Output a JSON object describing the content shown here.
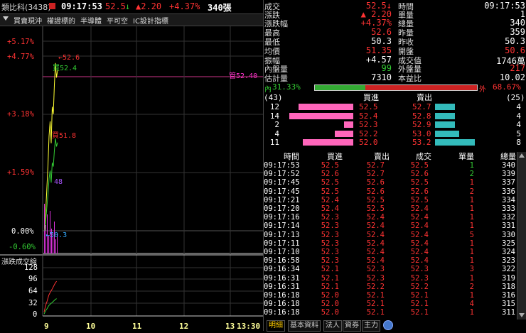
{
  "header": {
    "stock_name": "類比科(3438)",
    "time": "09:17:53",
    "price": "52.5",
    "price_arrow": "↓",
    "change": "▲2.20",
    "change_pct": "+4.37%",
    "volume": "340張"
  },
  "menu": {
    "items": [
      "買賣現沖",
      "權證標的",
      "半導體",
      "平可空",
      "IC設計指標"
    ]
  },
  "chart": {
    "y_labels": [
      {
        "text": "+5.17%",
        "color": "#ff3333"
      },
      {
        "text": "+4.77%",
        "color": "#ff3333"
      },
      {
        "text": "+3.18%",
        "color": "#ff3333"
      },
      {
        "text": "+1.59%",
        "color": "#ff3333"
      },
      {
        "text": "0.00%",
        "color": "#ffffff"
      },
      {
        "text": "-0.60%",
        "color": "#33cc33"
      }
    ],
    "annotations": {
      "high": "←52.6",
      "buy": "買52.4",
      "sell_right": "管52.40",
      "mid": "買51.8",
      "p48": "48",
      "low": "←50.3"
    },
    "sub_title": "漲跌成交線",
    "sub_y_labels": [
      "128",
      "96",
      "64",
      "32",
      "0"
    ],
    "x_labels": [
      "9",
      "10",
      "11",
      "12",
      "13",
      "13:30"
    ]
  },
  "chart_data": {
    "type": "line",
    "title": "",
    "x_ticks": [
      "9",
      "10",
      "11",
      "12",
      "13",
      "13:30"
    ],
    "y_ticks_pct": [
      "+5.17%",
      "+4.77%",
      "+3.18%",
      "+1.59%",
      "0.00%",
      "-0.60%"
    ],
    "series": [
      {
        "name": "price",
        "values": [
          50.3,
          50.6,
          50.9,
          51.2,
          51.6,
          51.8,
          51.5,
          52.0,
          51.9,
          52.3,
          52.6,
          52.4,
          52.5
        ]
      }
    ],
    "sub_series": [
      {
        "name": "漲跌成交線",
        "values": [
          10,
          28,
          40,
          55,
          63,
          70,
          78,
          86,
          92
        ]
      }
    ]
  },
  "quote": {
    "rows": [
      {
        "l1": "成交",
        "v1": "52.5↓",
        "c1": "#ff3333",
        "l2": "時間",
        "v2": "09:17:53",
        "c2": "#ffffff"
      },
      {
        "l1": "漲跌",
        "v1": "▲ 2.20",
        "c1": "#ff3333",
        "l2": "單量",
        "v2": "1",
        "c2": "#ffffff"
      },
      {
        "l1": "漲跌幅",
        "v1": "+4.37%",
        "c1": "#ff3333",
        "l2": "總量",
        "v2": "340",
        "c2": "#ffffff"
      },
      {
        "l1": "最高",
        "v1": "52.6",
        "c1": "#ff3333",
        "l2": "昨量",
        "v2": "359",
        "c2": "#ffffff"
      },
      {
        "l1": "最低",
        "v1": "50.3",
        "c1": "#ffffff",
        "l2": "昨收",
        "v2": "50.3",
        "c2": "#ffffff"
      },
      {
        "l1": "均價",
        "v1": "51.35",
        "c1": "#ff3333",
        "l2": "開盤",
        "v2": "50.6",
        "c2": "#ff3333"
      },
      {
        "l1": "振幅",
        "v1": "+4.57",
        "c1": "#ffffff",
        "l2": "成交值",
        "v2": "1746萬",
        "c2": "#ffffff"
      },
      {
        "l1": "內盤量",
        "v1": "99",
        "c1": "#33cc33",
        "l2": "外盤量",
        "v2": "217",
        "c2": "#ff3333"
      },
      {
        "l1": "估計量",
        "v1": "7310",
        "c1": "#ffffff",
        "l2": "本益比",
        "v2": "10.02",
        "c2": "#ffffff"
      }
    ],
    "inner_label": "內",
    "inner_pct": "31.33%",
    "inner_fraction": 0.3133,
    "outer_label": "外",
    "outer_pct": "68.67%"
  },
  "order_book": {
    "left_total": "(43)",
    "right_total": "(25)",
    "bid_header": "買進",
    "ask_header": "賣出",
    "rows": [
      {
        "bid_qty": "12",
        "bid": "52.5",
        "ask": "52.7",
        "ask_qty": "4",
        "bid_frac": 0.86,
        "ask_frac": 0.31
      },
      {
        "bid_qty": "14",
        "bid": "52.4",
        "ask": "52.8",
        "ask_qty": "4",
        "bid_frac": 1.0,
        "ask_frac": 0.31
      },
      {
        "bid_qty": "2",
        "bid": "52.3",
        "ask": "52.9",
        "ask_qty": "4",
        "bid_frac": 0.14,
        "ask_frac": 0.31
      },
      {
        "bid_qty": "4",
        "bid": "52.2",
        "ask": "53.0",
        "ask_qty": "5",
        "bid_frac": 0.29,
        "ask_frac": 0.38
      },
      {
        "bid_qty": "11",
        "bid": "52.0",
        "ask": "53.2",
        "ask_qty": "8",
        "bid_frac": 0.79,
        "ask_frac": 0.62
      }
    ]
  },
  "ticks": {
    "headers": [
      "時間",
      "買進",
      "賣出",
      "成交",
      "單量",
      "總量"
    ],
    "rows": [
      [
        "09:17:53",
        "52.5",
        "52.7",
        "52.5",
        "1",
        "340",
        "green"
      ],
      [
        "09:17:52",
        "52.6",
        "52.7",
        "52.6",
        "2",
        "339",
        "green"
      ],
      [
        "09:17:45",
        "52.5",
        "52.6",
        "52.5",
        "1",
        "337",
        "red"
      ],
      [
        "09:17:45",
        "52.5",
        "52.6",
        "52.6",
        "2",
        "336",
        "red"
      ],
      [
        "09:17:21",
        "52.4",
        "52.5",
        "52.5",
        "1",
        "334",
        "red"
      ],
      [
        "09:17:20",
        "52.4",
        "52.5",
        "52.4",
        "1",
        "333",
        "red"
      ],
      [
        "09:17:16",
        "52.3",
        "52.4",
        "52.4",
        "1",
        "332",
        "red"
      ],
      [
        "09:17:14",
        "52.3",
        "52.4",
        "52.4",
        "1",
        "331",
        "red"
      ],
      [
        "09:17:13",
        "52.3",
        "52.4",
        "52.4",
        "5",
        "330",
        "red"
      ],
      [
        "09:17:11",
        "52.3",
        "52.4",
        "52.4",
        "1",
        "325",
        "red"
      ],
      [
        "09:17:10",
        "52.3",
        "52.4",
        "52.4",
        "1",
        "324",
        "red"
      ],
      [
        "09:16:58",
        "52.3",
        "52.4",
        "52.4",
        "1",
        "323",
        "red"
      ],
      [
        "09:16:34",
        "52.1",
        "52.3",
        "52.3",
        "3",
        "322",
        "red"
      ],
      [
        "09:16:31",
        "52.1",
        "52.3",
        "52.3",
        "1",
        "319",
        "red"
      ],
      [
        "09:16:31",
        "52.1",
        "52.2",
        "52.2",
        "2",
        "318",
        "red"
      ],
      [
        "09:16:18",
        "52.0",
        "52.1",
        "52.1",
        "1",
        "316",
        "red"
      ],
      [
        "09:16:18",
        "52.0",
        "52.1",
        "52.1",
        "4",
        "315",
        "red"
      ],
      [
        "09:16:18",
        "52.0",
        "52.1",
        "52.1",
        "1",
        "311",
        "red"
      ]
    ]
  },
  "tabs": [
    "明細",
    "基本資料",
    "法人",
    "資券",
    "主力"
  ],
  "colors": {
    "up": "#ff3333",
    "down": "#33cc33",
    "bid_bar": "#ff66bb",
    "ask_bar": "#33bbbb"
  }
}
